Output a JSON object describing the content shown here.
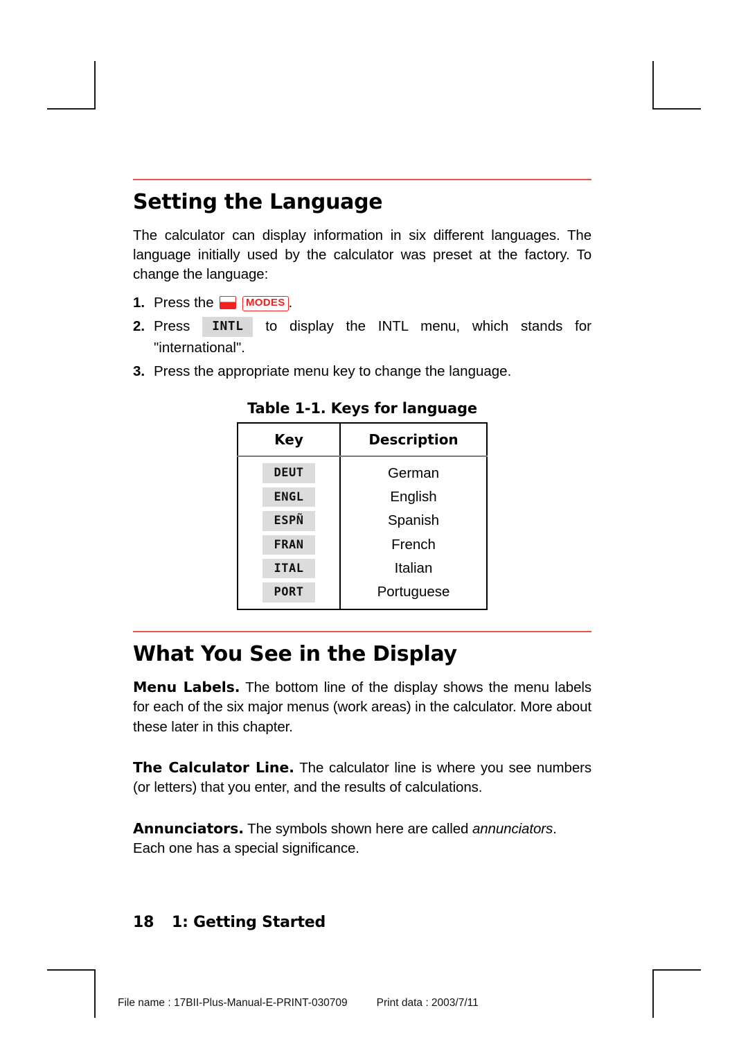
{
  "document": {
    "section1_title": "Setting the Language",
    "section1_intro": "The calculator can display information in six different languages. The language initially used by the calculator was preset at the factory. To change the language:",
    "steps": [
      {
        "num": "1.",
        "text_before": "Press the",
        "shift_key": "shift-key",
        "boxed_key": "MODES",
        "text_after": "."
      },
      {
        "num": "2.",
        "text_before": "Press",
        "menu_key": "INTL",
        "text_after": "to display the INTL menu, which stands for \"international\"."
      },
      {
        "num": "3.",
        "text": "Press the appropriate menu key to change the language."
      }
    ],
    "table": {
      "caption": "Table 1-1. Keys for language",
      "headers": [
        "Key",
        "Description"
      ],
      "rows": [
        {
          "key": "DEUT",
          "description": "German"
        },
        {
          "key": "ENGL",
          "description": "English"
        },
        {
          "key": "ESPÑ",
          "description": "Spanish"
        },
        {
          "key": "FRAN",
          "description": "French"
        },
        {
          "key": "ITAL",
          "description": "Italian"
        },
        {
          "key": "PORT",
          "description": "Portuguese"
        }
      ]
    },
    "section2_title": "What You See in the Display",
    "paragraphs": [
      {
        "lead": "Menu Labels.",
        "text": " The bottom line of the display shows the menu labels for each of the six major menus (work areas) in the calculator. More about these later in this chapter."
      },
      {
        "lead": "The Calculator Line.",
        "text": " The calculator line is where you see numbers (or letters) that you enter, and the results of calculations."
      },
      {
        "lead": "Annunciators.",
        "text_a": " The symbols shown here are called ",
        "italic": "annunciators",
        "text_b": ". Each one has a special significance."
      }
    ],
    "footer": {
      "page_number": "18",
      "chapter": "1: Getting Started"
    },
    "print_info": {
      "file_name": "File name : 17BII-Plus-Manual-E-PRINT-030709",
      "print_date": "Print data : 2003/7/11"
    },
    "colors": {
      "rule_red": "#e8534a",
      "key_red": "#ee2222",
      "key_gray": "#dcdcdc"
    }
  }
}
